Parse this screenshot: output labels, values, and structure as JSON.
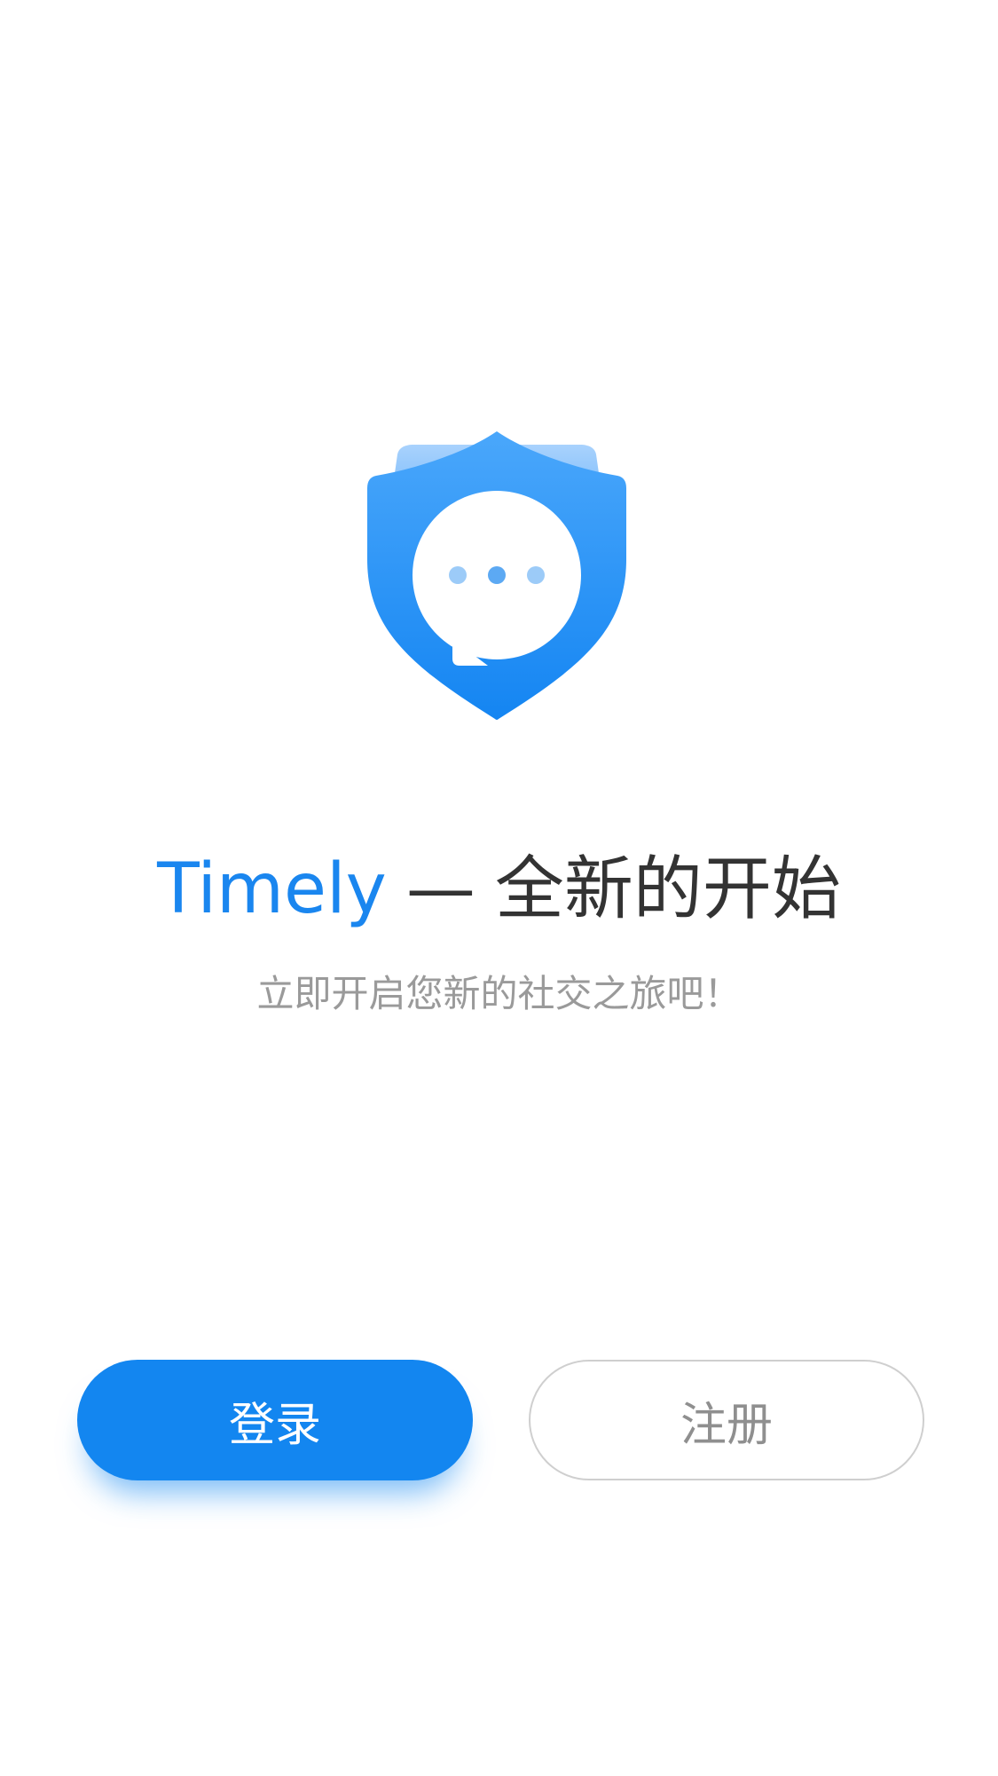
{
  "hero": {
    "logo_icon": "shield-chat-icon",
    "brand": "Timely",
    "dash": "—",
    "slogan": "全新的开始",
    "subtitle": "立即开启您新的社交之旅吧！"
  },
  "actions": {
    "login_label": "登录",
    "register_label": "注册"
  },
  "colors": {
    "accent": "#1386f0",
    "title_text": "#333333",
    "subtitle_text": "#9a9a9a",
    "register_border": "#cfcfcf",
    "background": "#ffffff"
  }
}
